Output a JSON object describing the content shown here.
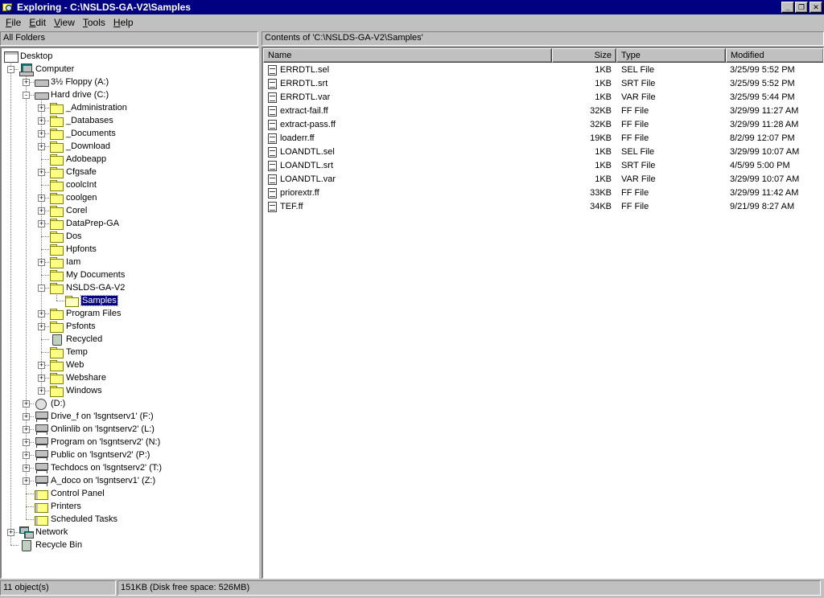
{
  "window": {
    "title": "Exploring - C:\\NSLDS-GA-V2\\Samples",
    "minimize_glyph": "_",
    "restore_glyph": "❐",
    "close_glyph": "✕"
  },
  "menu": [
    {
      "label": "File",
      "accel": "F",
      "rest": "ile"
    },
    {
      "label": "Edit",
      "accel": "E",
      "rest": "dit"
    },
    {
      "label": "View",
      "accel": "V",
      "rest": "iew"
    },
    {
      "label": "Tools",
      "accel": "T",
      "rest": "ools"
    },
    {
      "label": "Help",
      "accel": "H",
      "rest": "elp"
    }
  ],
  "left_header": "All Folders",
  "right_header": "Contents of 'C:\\NSLDS-GA-V2\\Samples'",
  "tree": [
    {
      "label": "Desktop",
      "level": 0,
      "icon": "desktop-icon",
      "expander": ""
    },
    {
      "label": "Computer",
      "level": 1,
      "icon": "computer-icon",
      "expander": "-"
    },
    {
      "label": "3½ Floppy (A:)",
      "level": 2,
      "icon": "floppy-drive-icon",
      "expander": "+"
    },
    {
      "label": "Hard drive (C:)",
      "level": 2,
      "icon": "hard-drive-icon",
      "expander": "-"
    },
    {
      "label": "_Administration",
      "level": 3,
      "icon": "folder-icon",
      "expander": "+"
    },
    {
      "label": "_Databases",
      "level": 3,
      "icon": "folder-icon",
      "expander": "+"
    },
    {
      "label": "_Documents",
      "level": 3,
      "icon": "folder-icon",
      "expander": "+"
    },
    {
      "label": "_Download",
      "level": 3,
      "icon": "folder-icon",
      "expander": "+"
    },
    {
      "label": "Adobeapp",
      "level": 3,
      "icon": "folder-icon",
      "expander": ""
    },
    {
      "label": "Cfgsafe",
      "level": 3,
      "icon": "folder-icon",
      "expander": "+"
    },
    {
      "label": "coolcInt",
      "level": 3,
      "icon": "folder-icon",
      "expander": ""
    },
    {
      "label": "coolgen",
      "level": 3,
      "icon": "folder-icon",
      "expander": "+"
    },
    {
      "label": "Corel",
      "level": 3,
      "icon": "folder-icon",
      "expander": "+"
    },
    {
      "label": "DataPrep-GA",
      "level": 3,
      "icon": "folder-icon",
      "expander": "+"
    },
    {
      "label": "Dos",
      "level": 3,
      "icon": "folder-icon",
      "expander": ""
    },
    {
      "label": "Hpfonts",
      "level": 3,
      "icon": "folder-icon",
      "expander": ""
    },
    {
      "label": "Iam",
      "level": 3,
      "icon": "folder-icon",
      "expander": "+"
    },
    {
      "label": "My Documents",
      "level": 3,
      "icon": "folder-icon",
      "expander": ""
    },
    {
      "label": "NSLDS-GA-V2",
      "level": 3,
      "icon": "folder-icon",
      "expander": "-"
    },
    {
      "label": "Samples",
      "level": 4,
      "icon": "folder-open-icon",
      "expander": "",
      "selected": true
    },
    {
      "label": "Program Files",
      "level": 3,
      "icon": "folder-icon",
      "expander": "+"
    },
    {
      "label": "Psfonts",
      "level": 3,
      "icon": "folder-icon",
      "expander": "+"
    },
    {
      "label": "Recycled",
      "level": 3,
      "icon": "recycled-icon",
      "expander": ""
    },
    {
      "label": "Temp",
      "level": 3,
      "icon": "folder-icon",
      "expander": ""
    },
    {
      "label": "Web",
      "level": 3,
      "icon": "folder-icon",
      "expander": "+"
    },
    {
      "label": "Webshare",
      "level": 3,
      "icon": "folder-icon",
      "expander": "+"
    },
    {
      "label": "Windows",
      "level": 3,
      "icon": "folder-icon",
      "expander": "+"
    },
    {
      "label": "(D:)",
      "level": 2,
      "icon": "cd-drive-icon",
      "expander": "+"
    },
    {
      "label": "Drive_f on 'lsgntserv1' (F:)",
      "level": 2,
      "icon": "network-drive-icon",
      "expander": "+"
    },
    {
      "label": "Onlinlib on 'lsgntserv2' (L:)",
      "level": 2,
      "icon": "network-drive-icon",
      "expander": "+"
    },
    {
      "label": "Program on 'lsgntserv2' (N:)",
      "level": 2,
      "icon": "network-drive-icon",
      "expander": "+"
    },
    {
      "label": "Public on 'lsgntserv2' (P:)",
      "level": 2,
      "icon": "network-drive-icon",
      "expander": "+"
    },
    {
      "label": "Techdocs on 'lsgntserv2' (T:)",
      "level": 2,
      "icon": "network-drive-icon",
      "expander": "+"
    },
    {
      "label": "A_doco on 'lsgntserv1' (Z:)",
      "level": 2,
      "icon": "network-drive-icon",
      "expander": "+"
    },
    {
      "label": "Control Panel",
      "level": 2,
      "icon": "control-panel-icon",
      "expander": ""
    },
    {
      "label": "Printers",
      "level": 2,
      "icon": "printers-icon",
      "expander": ""
    },
    {
      "label": "Scheduled Tasks",
      "level": 2,
      "icon": "scheduled-tasks-icon",
      "expander": ""
    },
    {
      "label": "Network",
      "level": 1,
      "icon": "network-icon",
      "expander": "+"
    },
    {
      "label": "Recycle Bin",
      "level": 1,
      "icon": "recycle-bin-icon",
      "expander": ""
    }
  ],
  "columns": [
    "Name",
    "Size",
    "Type",
    "Modified"
  ],
  "files": [
    {
      "name": "ERRDTL.sel",
      "size": "1KB",
      "type": "SEL File",
      "modified": "3/25/99 5:52 PM"
    },
    {
      "name": "ERRDTL.srt",
      "size": "1KB",
      "type": "SRT File",
      "modified": "3/25/99 5:52 PM"
    },
    {
      "name": "ERRDTL.var",
      "size": "1KB",
      "type": "VAR File",
      "modified": "3/25/99 5:44 PM"
    },
    {
      "name": "extract-fail.ff",
      "size": "32KB",
      "type": "FF File",
      "modified": "3/29/99 11:27 AM"
    },
    {
      "name": "extract-pass.ff",
      "size": "32KB",
      "type": "FF File",
      "modified": "3/29/99 11:28 AM"
    },
    {
      "name": "loaderr.ff",
      "size": "19KB",
      "type": "FF File",
      "modified": "8/2/99 12:07 PM"
    },
    {
      "name": "LOANDTL.sel",
      "size": "1KB",
      "type": "SEL File",
      "modified": "3/29/99 10:07 AM"
    },
    {
      "name": "LOANDTL.srt",
      "size": "1KB",
      "type": "SRT File",
      "modified": "4/5/99 5:00 PM"
    },
    {
      "name": "LOANDTL.var",
      "size": "1KB",
      "type": "VAR File",
      "modified": "3/29/99 10:07 AM"
    },
    {
      "name": "priorextr.ff",
      "size": "33KB",
      "type": "FF File",
      "modified": "3/29/99 11:42 AM"
    },
    {
      "name": "TEF.ff",
      "size": "34KB",
      "type": "FF File",
      "modified": "9/21/99 8:27 AM"
    }
  ],
  "status": {
    "objects": "11 object(s)",
    "disk": "151KB (Disk free space: 526MB)"
  },
  "colors": {
    "titlebar": "#000080",
    "selection": "#000080",
    "face": "#c0c0c0"
  }
}
